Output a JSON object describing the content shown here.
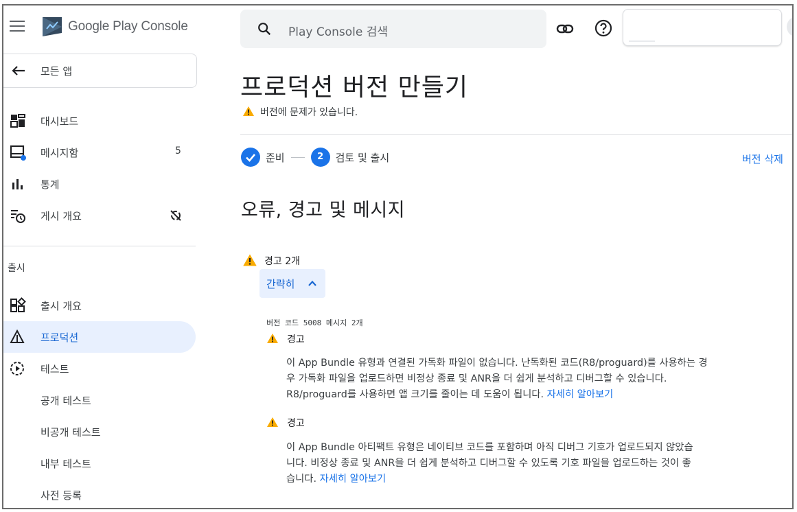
{
  "header": {
    "brand": "Google Play Console",
    "search_placeholder": "Play Console 검색"
  },
  "sidebar": {
    "back_label": "모든 앱",
    "items": [
      {
        "label": "대시보드",
        "icon": "dashboard-icon"
      },
      {
        "label": "메시지함",
        "icon": "inbox-icon",
        "count": "5"
      },
      {
        "label": "통계",
        "icon": "bar-chart-icon"
      },
      {
        "label": "게시 개요",
        "icon": "publishing-overview-icon"
      }
    ],
    "section_label": "출시",
    "release_items": [
      {
        "label": "출시 개요",
        "icon": "release-overview-icon"
      },
      {
        "label": "프로덕션",
        "icon": "production-icon",
        "active": true
      },
      {
        "label": "테스트",
        "icon": "testing-icon"
      },
      {
        "label": "공개 테스트"
      },
      {
        "label": "비공개 테스트"
      },
      {
        "label": "내부 테스트"
      },
      {
        "label": "사전 등록"
      }
    ]
  },
  "main": {
    "title": "프로덕션 버전 만들기",
    "version_warning": "버전에 문제가 있습니다.",
    "steps": [
      {
        "label": "준비",
        "state": "done"
      },
      {
        "label": "검토 및 출시",
        "number": "2",
        "state": "current"
      }
    ],
    "delete_label": "버전 삭제",
    "section_title": "오류, 경고 및 메시지",
    "warning_count": "경고 2개",
    "collapse_label": "간략히",
    "version_code_label": "버전 코드 5008 메시지 2개",
    "messages": [
      {
        "heading": "경고",
        "line1": "이 App Bundle 유형과 연결된 가독화 파일이 없습니다. 난독화된 코드(R8/proguard)를 사용하는 경",
        "line2": "우 가독화 파일을 업로드하면 비정상 종료 및 ANR을 더 쉽게 분석하고 디버그할 수 있습니다.",
        "line3": "R8/proguard를 사용하면 앱 크기를 줄이는 데 도움이 됩니다.",
        "link": "자세히 알아보기"
      },
      {
        "heading": "경고",
        "line1": "이 App Bundle 아티팩트 유형은 네이티브 코드를 포함하며 아직 디버그 기호가 업로드되지 않았습",
        "line2": "니다. 비정상 종료 및 ANR을 더 쉽게 분석하고 디버그할 수 있도록 기호 파일을 업로드하는 것이 좋",
        "line3": "습니다.",
        "link": "자세히 알아보기"
      }
    ]
  },
  "colors": {
    "accent": "#1a73e8",
    "active_bg": "#e8f0fe",
    "warning": "#f9ab00"
  }
}
